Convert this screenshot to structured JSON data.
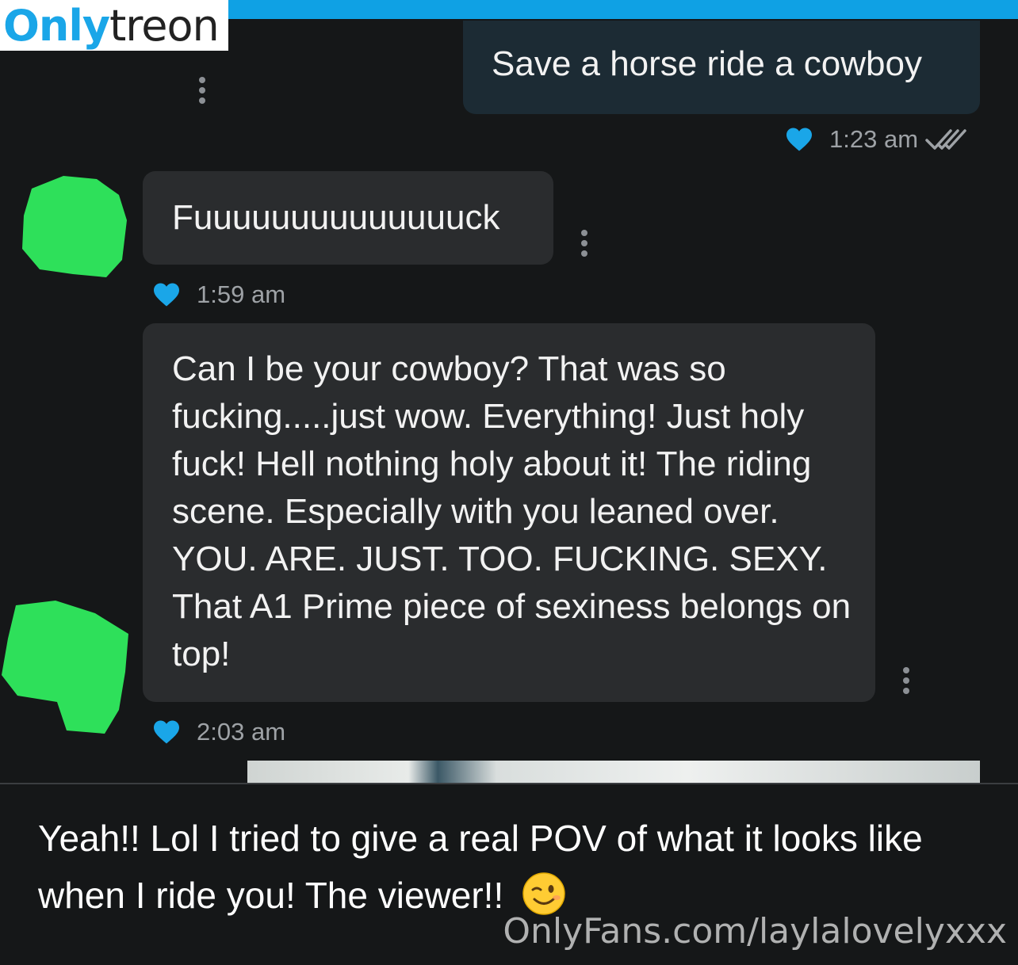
{
  "header": {
    "logo_part1": "Only",
    "logo_part2": "treon",
    "accent_color": "#0fa1e4"
  },
  "messages": [
    {
      "direction": "outgoing",
      "text": "Save a horse ride a cowboy",
      "time": "1:23 am",
      "liked": true,
      "read": true
    },
    {
      "direction": "incoming",
      "text": "Fuuuuuuuuuuuuuuck",
      "time": "1:59 am",
      "liked": true
    },
    {
      "direction": "incoming",
      "text": "Can I be your cowboy? That was so fucking.....just wow. Everything! Just holy fuck! Hell nothing holy about it! The riding scene. Especially with you leaned over. YOU. ARE. JUST. TOO. FUCKING. SEXY. That A1 Prime piece of sexiness belongs on top!",
      "time": "2:03 am",
      "liked": true
    }
  ],
  "caption": {
    "text": "Yeah!! Lol I tried to give a real POV of what it looks like when I ride you! The viewer!!",
    "emoji": "winking-face"
  },
  "watermark": "OnlyFans.com/laylalovelyxxx",
  "colors": {
    "heart": "#1aa6e8",
    "avatar_censor": "#2ee05a",
    "outgoing_bubble": "#1c2b34",
    "incoming_bubble": "#2a2c2e"
  }
}
